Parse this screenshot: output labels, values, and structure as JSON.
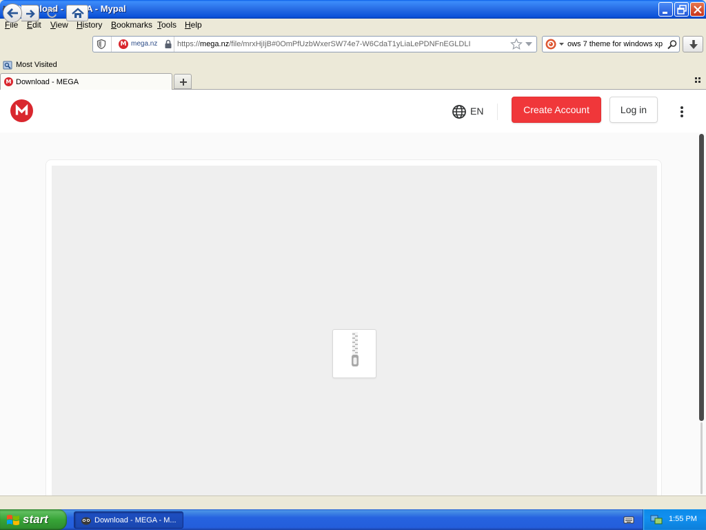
{
  "window": {
    "title": "Download - MEGA - Mypal"
  },
  "menu": [
    {
      "accel": "F",
      "rest": "ile"
    },
    {
      "accel": "E",
      "rest": "dit"
    },
    {
      "accel": "V",
      "rest": "iew"
    },
    {
      "accel": "H",
      "rest": "istory"
    },
    {
      "accel": "B",
      "rest": "ookmarks"
    },
    {
      "accel": "T",
      "rest": "ools"
    },
    {
      "accel": "H",
      "rest": "elp"
    }
  ],
  "urlbar": {
    "site_label": "mega.nz",
    "scheme": "https://",
    "host": "mega.nz",
    "path": "/file/mrxHjIjB#0OmPfUzbWxerSW74e7-W6CdaT1yLiaLePDNFnEGLDLI"
  },
  "search": {
    "value": "ows 7 theme for windows xp"
  },
  "bookmarks": {
    "most_visited": "Most Visited"
  },
  "tabs": [
    {
      "label": "Download - MEGA"
    }
  ],
  "mega": {
    "logo_letter": "M",
    "language": "EN",
    "create_account": "Create Account",
    "login": "Log in",
    "accent_color": "#d9272e"
  },
  "taskbar": {
    "start_label": "start",
    "task_label": "Download - MEGA - M...",
    "clock": "1:55 PM"
  }
}
